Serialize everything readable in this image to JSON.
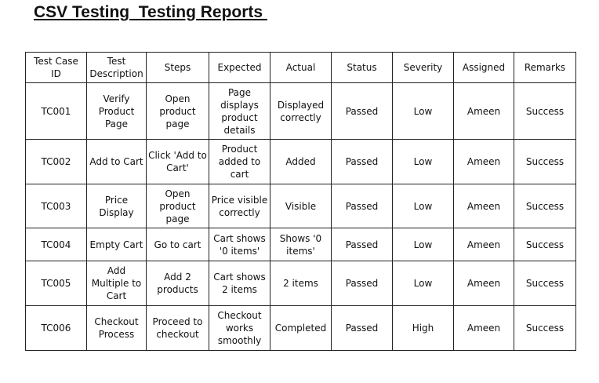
{
  "title": "CSV Testing  Testing Reports ",
  "headers": [
    "Test Case ID",
    "Test Description",
    "Steps",
    "Expected",
    "Actual",
    "Status",
    "Severity",
    "Assigned",
    "Remarks"
  ],
  "rows": [
    [
      "TC001",
      "Verify Product Page",
      "Open product page",
      "Page displays product details",
      "Displayed correctly",
      "Passed",
      "Low",
      "Ameen",
      "Success"
    ],
    [
      "TC002",
      "Add to Cart",
      "Click 'Add to Cart'",
      "Product added to cart",
      "Added",
      "Passed",
      "Low",
      "Ameen",
      "Success"
    ],
    [
      "TC003",
      "Price Display",
      "Open product page",
      "Price visible correctly",
      "Visible",
      "Passed",
      "Low",
      "Ameen",
      "Success"
    ],
    [
      "TC004",
      "Empty Cart",
      "Go to cart",
      "Cart shows '0 items'",
      "Shows '0 items'",
      "Passed",
      "Low",
      "Ameen",
      "Success"
    ],
    [
      "TC005",
      "Add Multiple to Cart",
      "Add 2 products",
      "Cart shows 2 items",
      "2 items",
      "Passed",
      "Low",
      "Ameen",
      "Success"
    ],
    [
      "TC006",
      "Checkout Process",
      "Proceed to checkout",
      "Checkout works smoothly",
      "Completed",
      "Passed",
      "High",
      "Ameen",
      "Success"
    ]
  ]
}
